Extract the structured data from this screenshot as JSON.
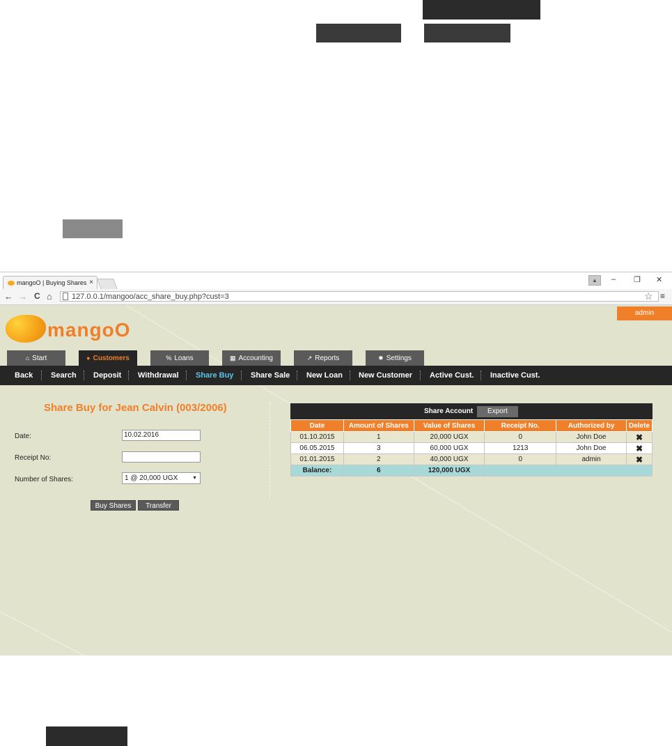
{
  "browser": {
    "tab_title": "mangoO | Buying Shares",
    "tab_close": "×",
    "url": "127.0.0.1/mangoo/acc_share_buy.php?cust=3",
    "back": "←",
    "forward": "→",
    "reload": "C",
    "home": "⌂",
    "minimize": "–",
    "restore": "❐",
    "close": "✕",
    "star": "☆",
    "menu": "≡"
  },
  "header": {
    "logo_text": "mangoO",
    "admin_label": "admin"
  },
  "main_tabs": [
    {
      "label": "Start",
      "icon": "home-icon",
      "glyph": "⌂"
    },
    {
      "label": "Customers",
      "icon": "user-icon",
      "glyph": "●"
    },
    {
      "label": "Loans",
      "icon": "percent-icon",
      "glyph": "%"
    },
    {
      "label": "Accounting",
      "icon": "calculator-icon",
      "glyph": "▦"
    },
    {
      "label": "Reports",
      "icon": "chart-line-icon",
      "glyph": "↗"
    },
    {
      "label": "Settings",
      "icon": "gear-icon",
      "glyph": "✹"
    }
  ],
  "sub_nav": [
    "Back",
    "Search",
    "Deposit",
    "Withdrawal",
    "Share Buy",
    "Share Sale",
    "New Loan",
    "New Customer",
    "Active Cust.",
    "Inactive Cust."
  ],
  "form": {
    "title": "Share Buy for Jean Calvin (003/2006)",
    "date_label": "Date:",
    "date_value": "10.02.2016",
    "receipt_label": "Receipt No:",
    "receipt_value": "",
    "shares_label": "Number of Shares:",
    "shares_selected": "1 @ 20,000 UGX",
    "buy_button": "Buy Shares",
    "transfer_button": "Transfer"
  },
  "account": {
    "title": "Share Account",
    "export_label": "Export",
    "columns": [
      "Date",
      "Amount of Shares",
      "Value of Shares",
      "Receipt No.",
      "Authorized by",
      "Delete"
    ],
    "rows": [
      {
        "date": "01.10.2015",
        "amount": "1",
        "value": "20,000 UGX",
        "receipt": "0",
        "authorized": "John Doe"
      },
      {
        "date": "06.05.2015",
        "amount": "3",
        "value": "60,000 UGX",
        "receipt": "1213",
        "authorized": "John Doe"
      },
      {
        "date": "01.01.2015",
        "amount": "2",
        "value": "40,000 UGX",
        "receipt": "0",
        "authorized": "admin"
      }
    ],
    "delete_glyph": "✖",
    "balance_label": "Balance:",
    "balance_amount": "6",
    "balance_value": "120,000 UGX"
  }
}
